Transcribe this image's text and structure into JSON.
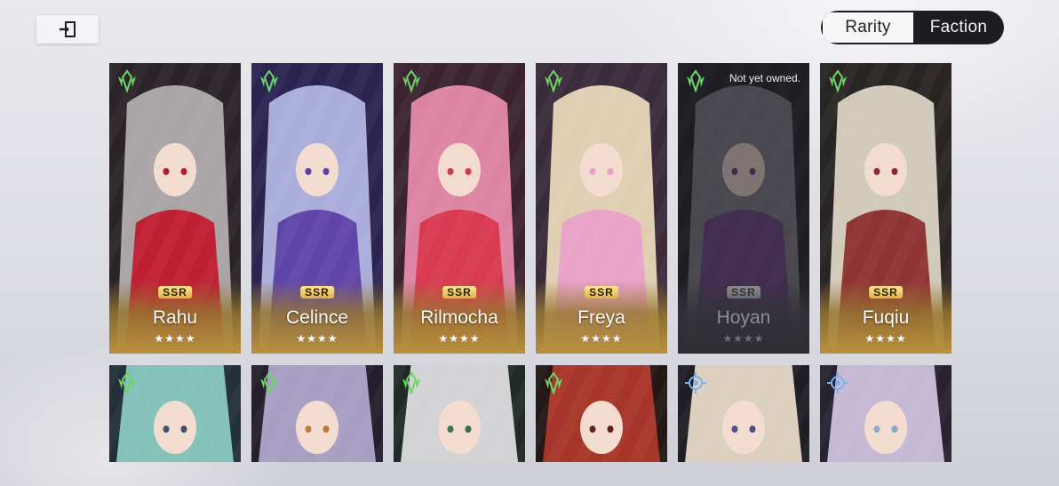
{
  "header": {
    "back_icon": "exit-icon",
    "sort_options": [
      {
        "label": "Rarity",
        "active": true
      },
      {
        "label": "Faction",
        "active": false
      }
    ]
  },
  "characters_row1": [
    {
      "name": "Rahu",
      "rarity": "SSR",
      "stars": "★★★★",
      "owned": true,
      "faction_icon": "green-faction-icon",
      "palette": [
        "#2a2428",
        "#b7b2b4",
        "#c0182b"
      ]
    },
    {
      "name": "Celince",
      "rarity": "SSR",
      "stars": "★★★★",
      "owned": true,
      "faction_icon": "green-faction-icon",
      "palette": [
        "#2c2450",
        "#b8bde8",
        "#5b3fa6"
      ]
    },
    {
      "name": "Rilmocha",
      "rarity": "SSR",
      "stars": "★★★★",
      "owned": true,
      "faction_icon": "green-faction-icon",
      "palette": [
        "#3b2430",
        "#f08fb0",
        "#d8364c"
      ]
    },
    {
      "name": "Freya",
      "rarity": "SSR",
      "stars": "★★★★",
      "owned": true,
      "faction_icon": "green-faction-icon",
      "palette": [
        "#3a2c3a",
        "#f3e0c0",
        "#e8a0c8"
      ]
    },
    {
      "name": "Hoyan",
      "rarity": "SSR",
      "stars": "★★★★",
      "owned": false,
      "status": "Not yet owned.",
      "faction_icon": "green-faction-icon",
      "palette": [
        "#1f1f23",
        "#8d8790",
        "#6b3f86"
      ]
    },
    {
      "name": "Fuqiu",
      "rarity": "SSR",
      "stars": "★★★★",
      "owned": true,
      "faction_icon": "green-faction-icon",
      "palette": [
        "#2a2525",
        "#e3dccb",
        "#8b2b2b"
      ]
    }
  ],
  "characters_row2": [
    {
      "faction_icon": "green-faction-icon",
      "palette": [
        "#23303a",
        "#8fd2c8",
        "#3b4d6b"
      ]
    },
    {
      "faction_icon": "green-faction-icon",
      "palette": [
        "#241f2c",
        "#b6acd4",
        "#b57a3a"
      ]
    },
    {
      "faction_icon": "green-faction-icon",
      "palette": [
        "#202a26",
        "#e6e6e8",
        "#3c6f47"
      ]
    },
    {
      "faction_icon": "green-faction-icon",
      "palette": [
        "#241816",
        "#b6382b",
        "#5a1f1b"
      ]
    },
    {
      "faction_icon": "blue-faction-icon",
      "palette": [
        "#1e1e24",
        "#efe2cf",
        "#4a4f8a"
      ]
    },
    {
      "faction_icon": "blue-faction-icon",
      "palette": [
        "#272331",
        "#d7c9e8",
        "#8ea6c9"
      ]
    }
  ]
}
